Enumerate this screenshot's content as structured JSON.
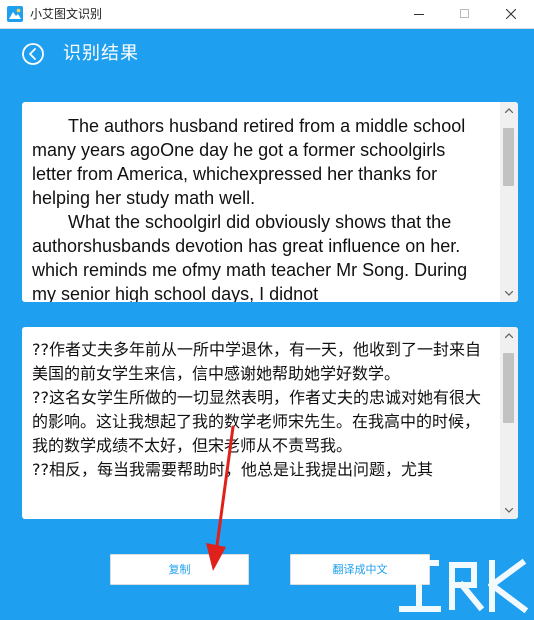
{
  "window": {
    "title": "小艾图文识别"
  },
  "header": {
    "title": "识别结果"
  },
  "recognized_text": {
    "paragraphs": [
      "The authors husband retired from a middle school many years agoOne day he got a former schoolgirls letter from America, whichexpressed her thanks for helping her study math well.",
      "What the schoolgirl did obviously shows that the authorshusbands devotion has great influence on her. which reminds me ofmy math teacher Mr Song. During my senior high school days, I didnot"
    ]
  },
  "translated_text": {
    "paragraphs": [
      "??作者丈夫多年前从一所中学退休，有一天，他收到了一封来自美国的前女学生来信，信中感谢她帮助她学好数学。",
      "??这名女学生所做的一切显然表明，作者丈夫的忠诚对她有很大的影响。这让我想起了我的数学老师宋先生。在我高中的时候，我的数学成绩不太好，但宋老师从不责骂我。",
      "??相反，每当我需要帮助时，他总是让我提出问题，尤其"
    ]
  },
  "buttons": {
    "copy": "复制",
    "translate": "翻译成中文"
  },
  "colors": {
    "background": "#1E9FF0",
    "panel": "#FFFFFF",
    "arrow": "#E0201B"
  },
  "icons": {
    "app": "app-logo-icon",
    "back": "back-arrow-icon"
  }
}
